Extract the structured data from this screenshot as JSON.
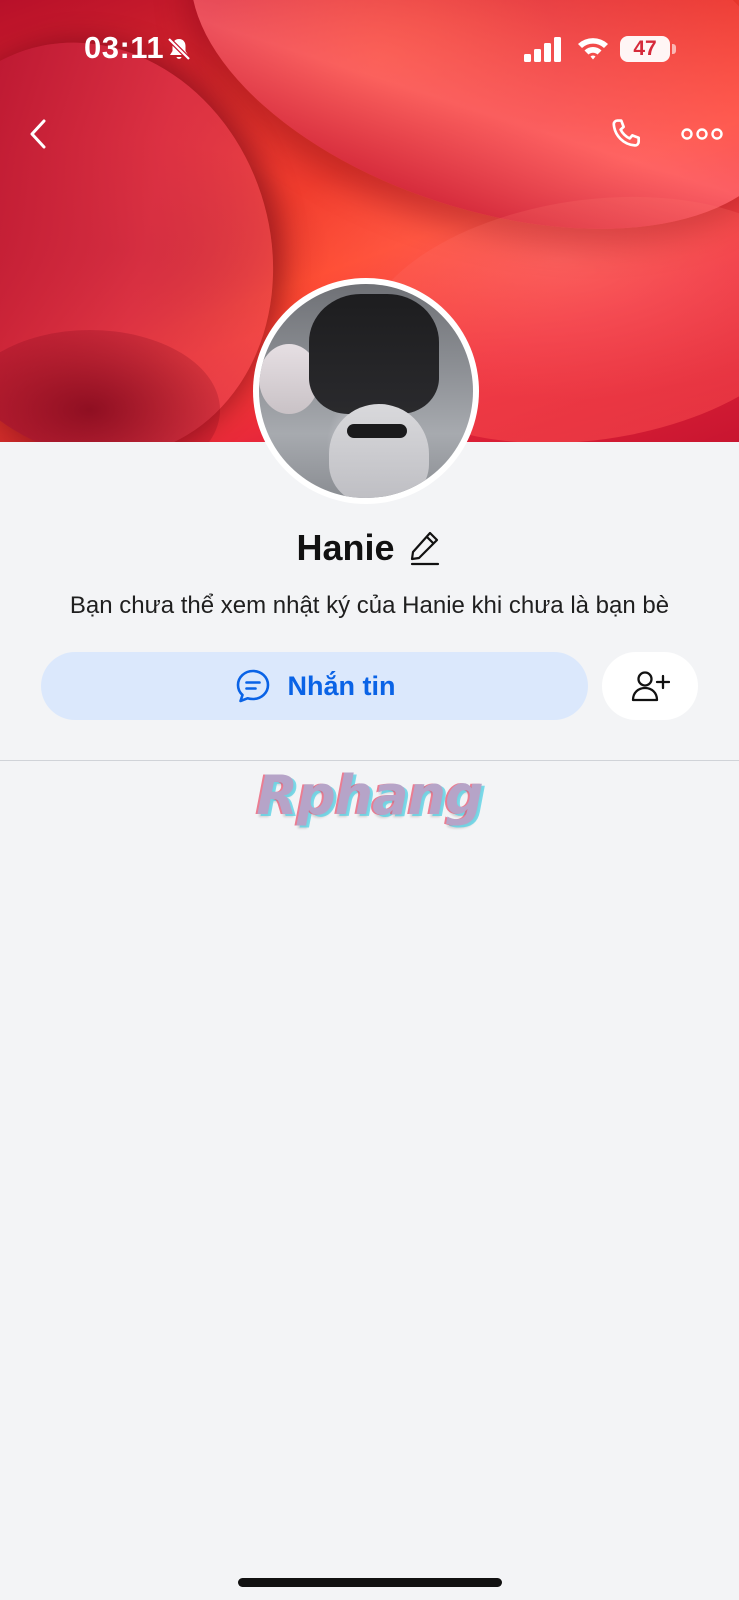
{
  "status_bar": {
    "time": "03:11",
    "battery": "47",
    "icons": [
      "bell-off-icon",
      "signal-icon",
      "wifi-icon",
      "battery-icon"
    ]
  },
  "nav": {
    "icons": [
      "back-icon",
      "phone-icon",
      "more-icon"
    ]
  },
  "profile": {
    "name": "Hanie",
    "privacy_note": "Bạn chưa thể xem nhật ký của Hanie khi chưa là bạn bè"
  },
  "actions": {
    "message_label": "Nhắn tin",
    "message_icon": "chat-bubble-icon",
    "add_friend_icon": "add-friend-icon"
  },
  "watermark": "Rphang",
  "colors": {
    "accent": "#0a63e6",
    "message_button_bg": "#dbe8fc",
    "page_bg": "#f3f4f6",
    "battery_text": "#d62a3a"
  }
}
